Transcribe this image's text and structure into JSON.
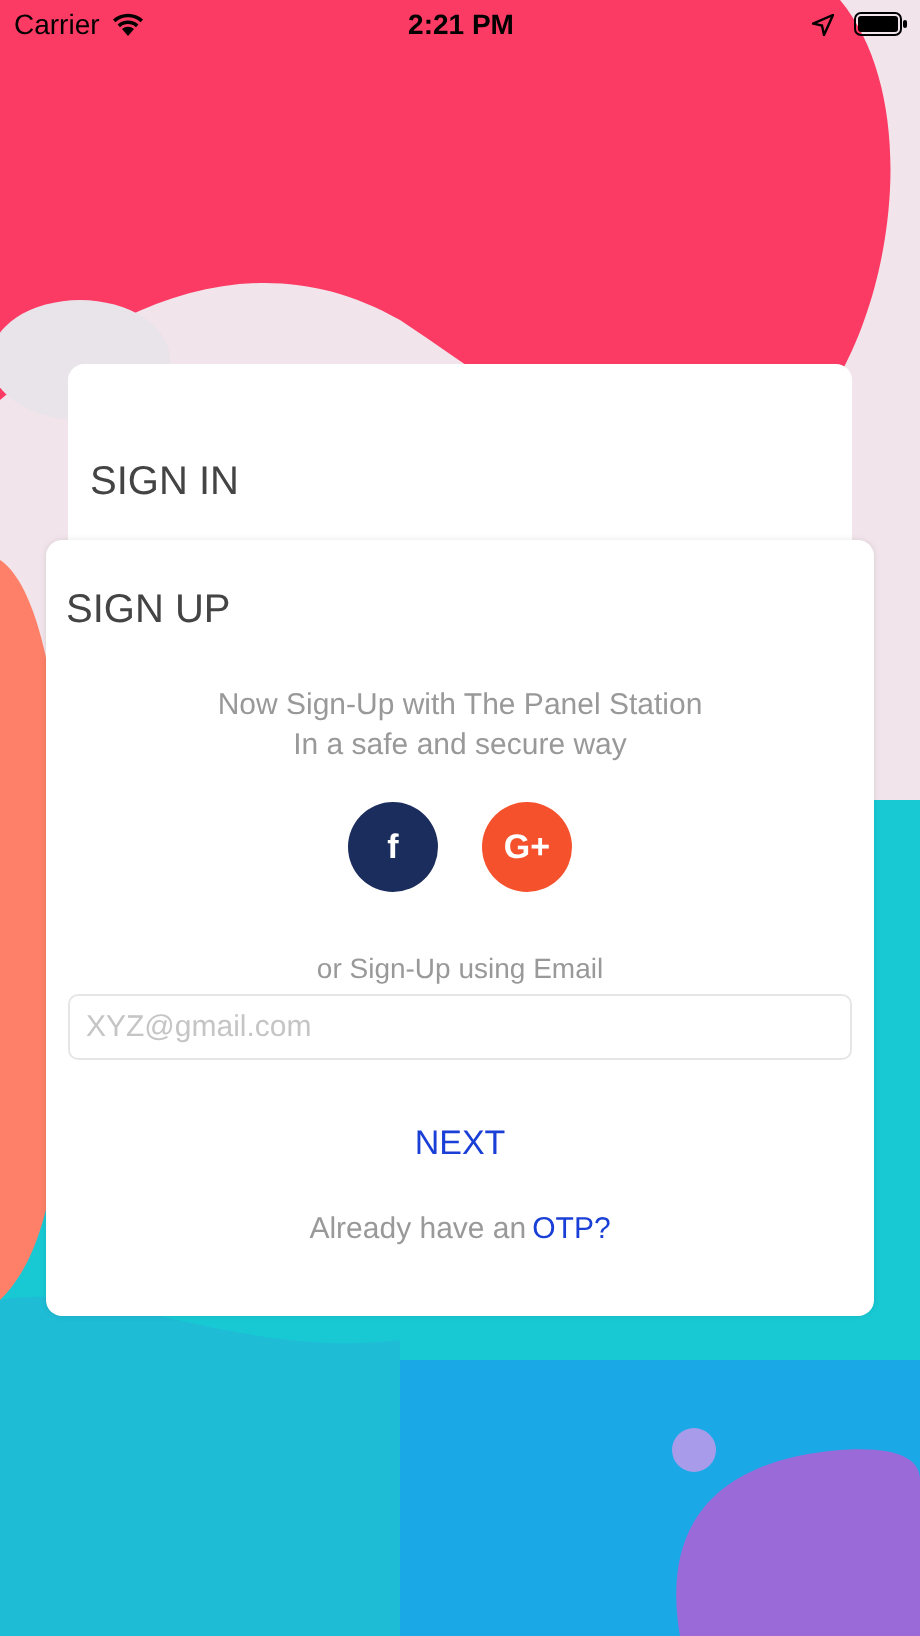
{
  "status_bar": {
    "carrier": "Carrier",
    "time": "2:21 PM"
  },
  "sign_in": {
    "title": "SIGN IN"
  },
  "sign_up": {
    "title": "SIGN UP",
    "subtitle": [
      "Now Sign-Up with The Panel Station",
      "In a safe and secure way"
    ],
    "social_buttons": [
      {
        "label": "f",
        "color": "#1b2d5c"
      },
      {
        "label": "G+",
        "color": "#f4512c"
      }
    ],
    "email_hint": "or Sign-Up using Email",
    "email": {
      "placeholder": "XYZ@gmail.com"
    },
    "next": "NEXT",
    "otp_prompt": "Already have an",
    "otp_link": "OTP?"
  }
}
